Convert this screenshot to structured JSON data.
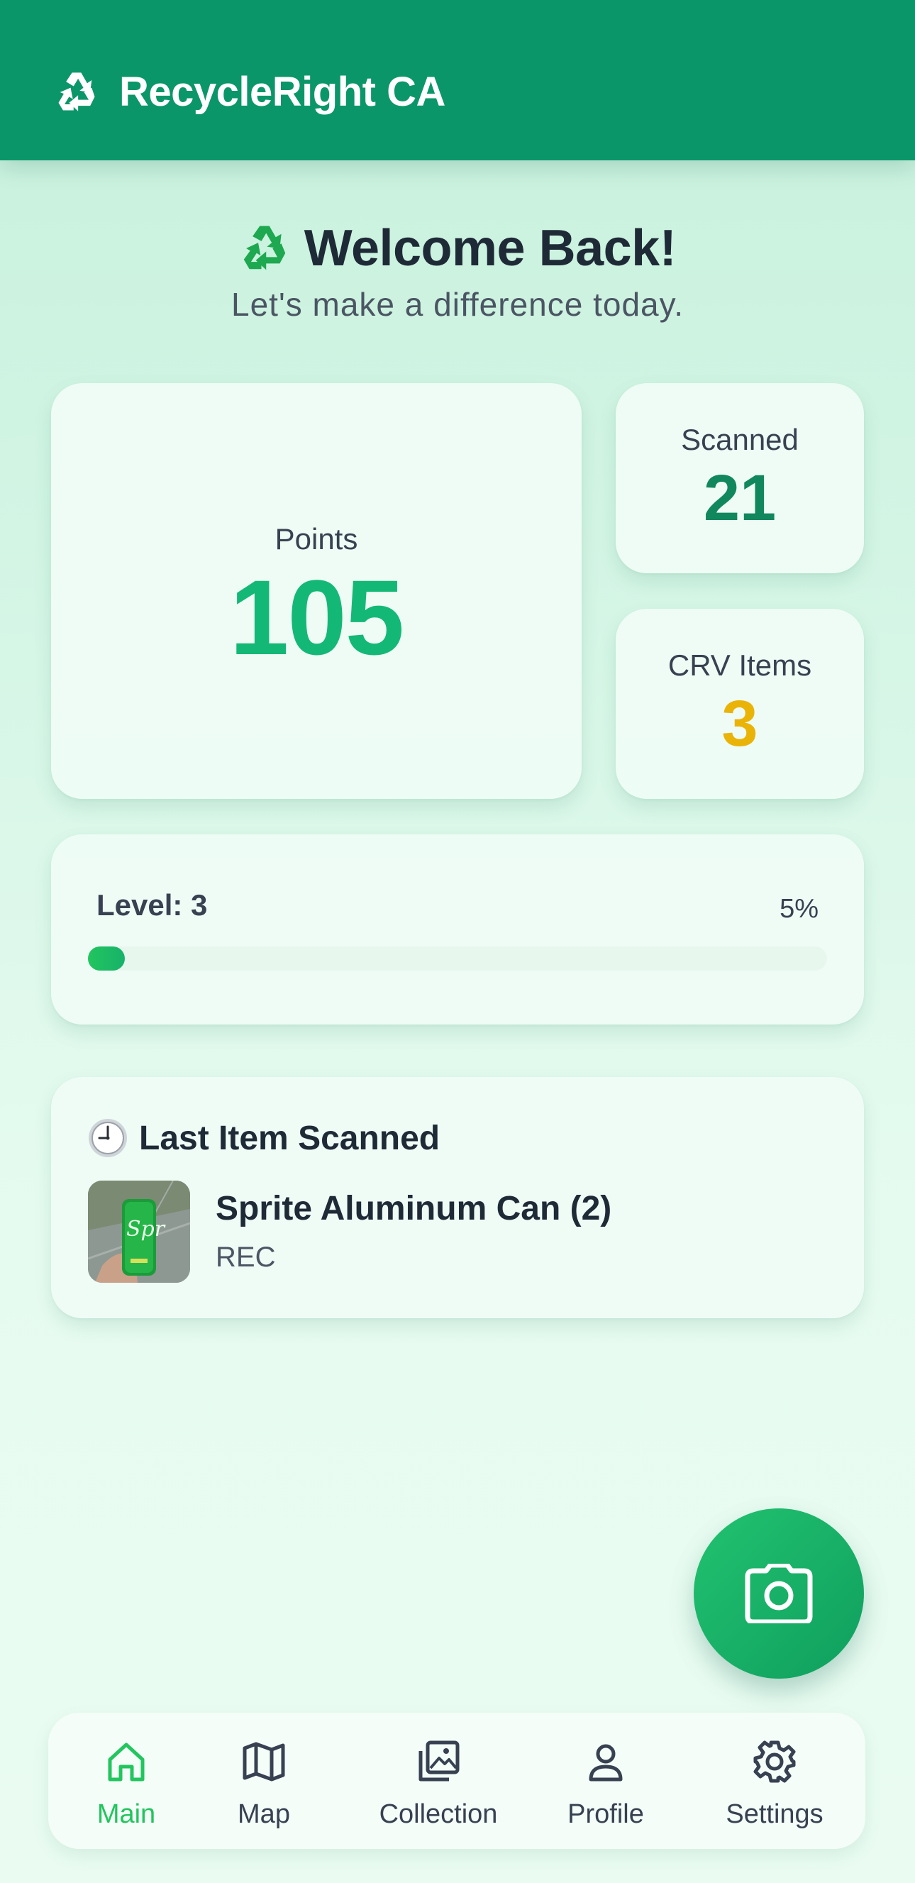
{
  "header": {
    "title": "RecycleRight CA",
    "logo_icon": "recycle-icon"
  },
  "welcome": {
    "title": "Welcome Back!",
    "subtitle": "Let's make a difference today.",
    "icon": "recycle-emoji-icon"
  },
  "stats": {
    "points": {
      "label": "Points",
      "value": "105"
    },
    "scanned": {
      "label": "Scanned",
      "value": "21"
    },
    "crv": {
      "label": "CRV Items",
      "value": "3"
    }
  },
  "level": {
    "label": "Level: 3",
    "percent_text": "5%",
    "progress": 0.05
  },
  "last_scanned": {
    "heading": "Last Item Scanned",
    "icon": "clock-icon",
    "item_name": "Sprite Aluminum Can (2)",
    "item_tag": "REC"
  },
  "fab": {
    "icon": "camera-icon"
  },
  "nav": {
    "items": [
      {
        "label": "Main",
        "icon": "home-icon",
        "active": true
      },
      {
        "label": "Map",
        "icon": "map-icon",
        "active": false
      },
      {
        "label": "Collection",
        "icon": "gallery-icon",
        "active": false
      },
      {
        "label": "Profile",
        "icon": "user-icon",
        "active": false
      },
      {
        "label": "Settings",
        "icon": "gear-icon",
        "active": false
      }
    ]
  },
  "colors": {
    "brand": "#0b9669",
    "points": "#14b876",
    "scanned": "#11875d",
    "crv": "#eab308",
    "nav_active": "#22c55e"
  }
}
